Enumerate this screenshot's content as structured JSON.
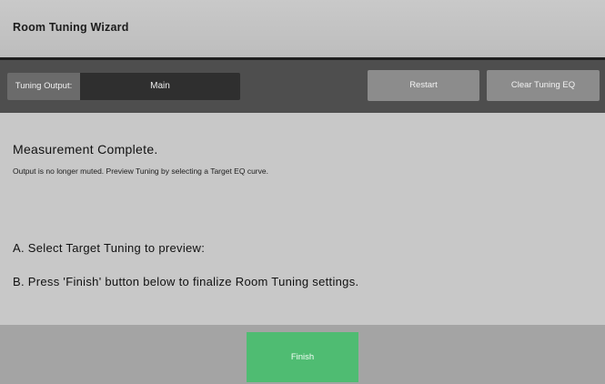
{
  "window": {
    "title": "Room Tuning Wizard"
  },
  "toolbar": {
    "output_label": "Tuning Output:",
    "output_value": "Main",
    "restart_label": "Restart",
    "clear_label": "Clear Tuning EQ"
  },
  "content": {
    "heading": "Measurement Complete.",
    "subtext": "Output is no longer muted. Preview Tuning by selecting a Target EQ curve.",
    "step_a": "A. Select Target Tuning to preview:",
    "step_b": "B. Press 'Finish' button below to finalize Room Tuning settings."
  },
  "footer": {
    "finish_label": "Finish"
  },
  "colors": {
    "finish_button": "#4fbc72",
    "toolbar_background": "#4e4e4e",
    "content_background": "#c8c8c8"
  }
}
